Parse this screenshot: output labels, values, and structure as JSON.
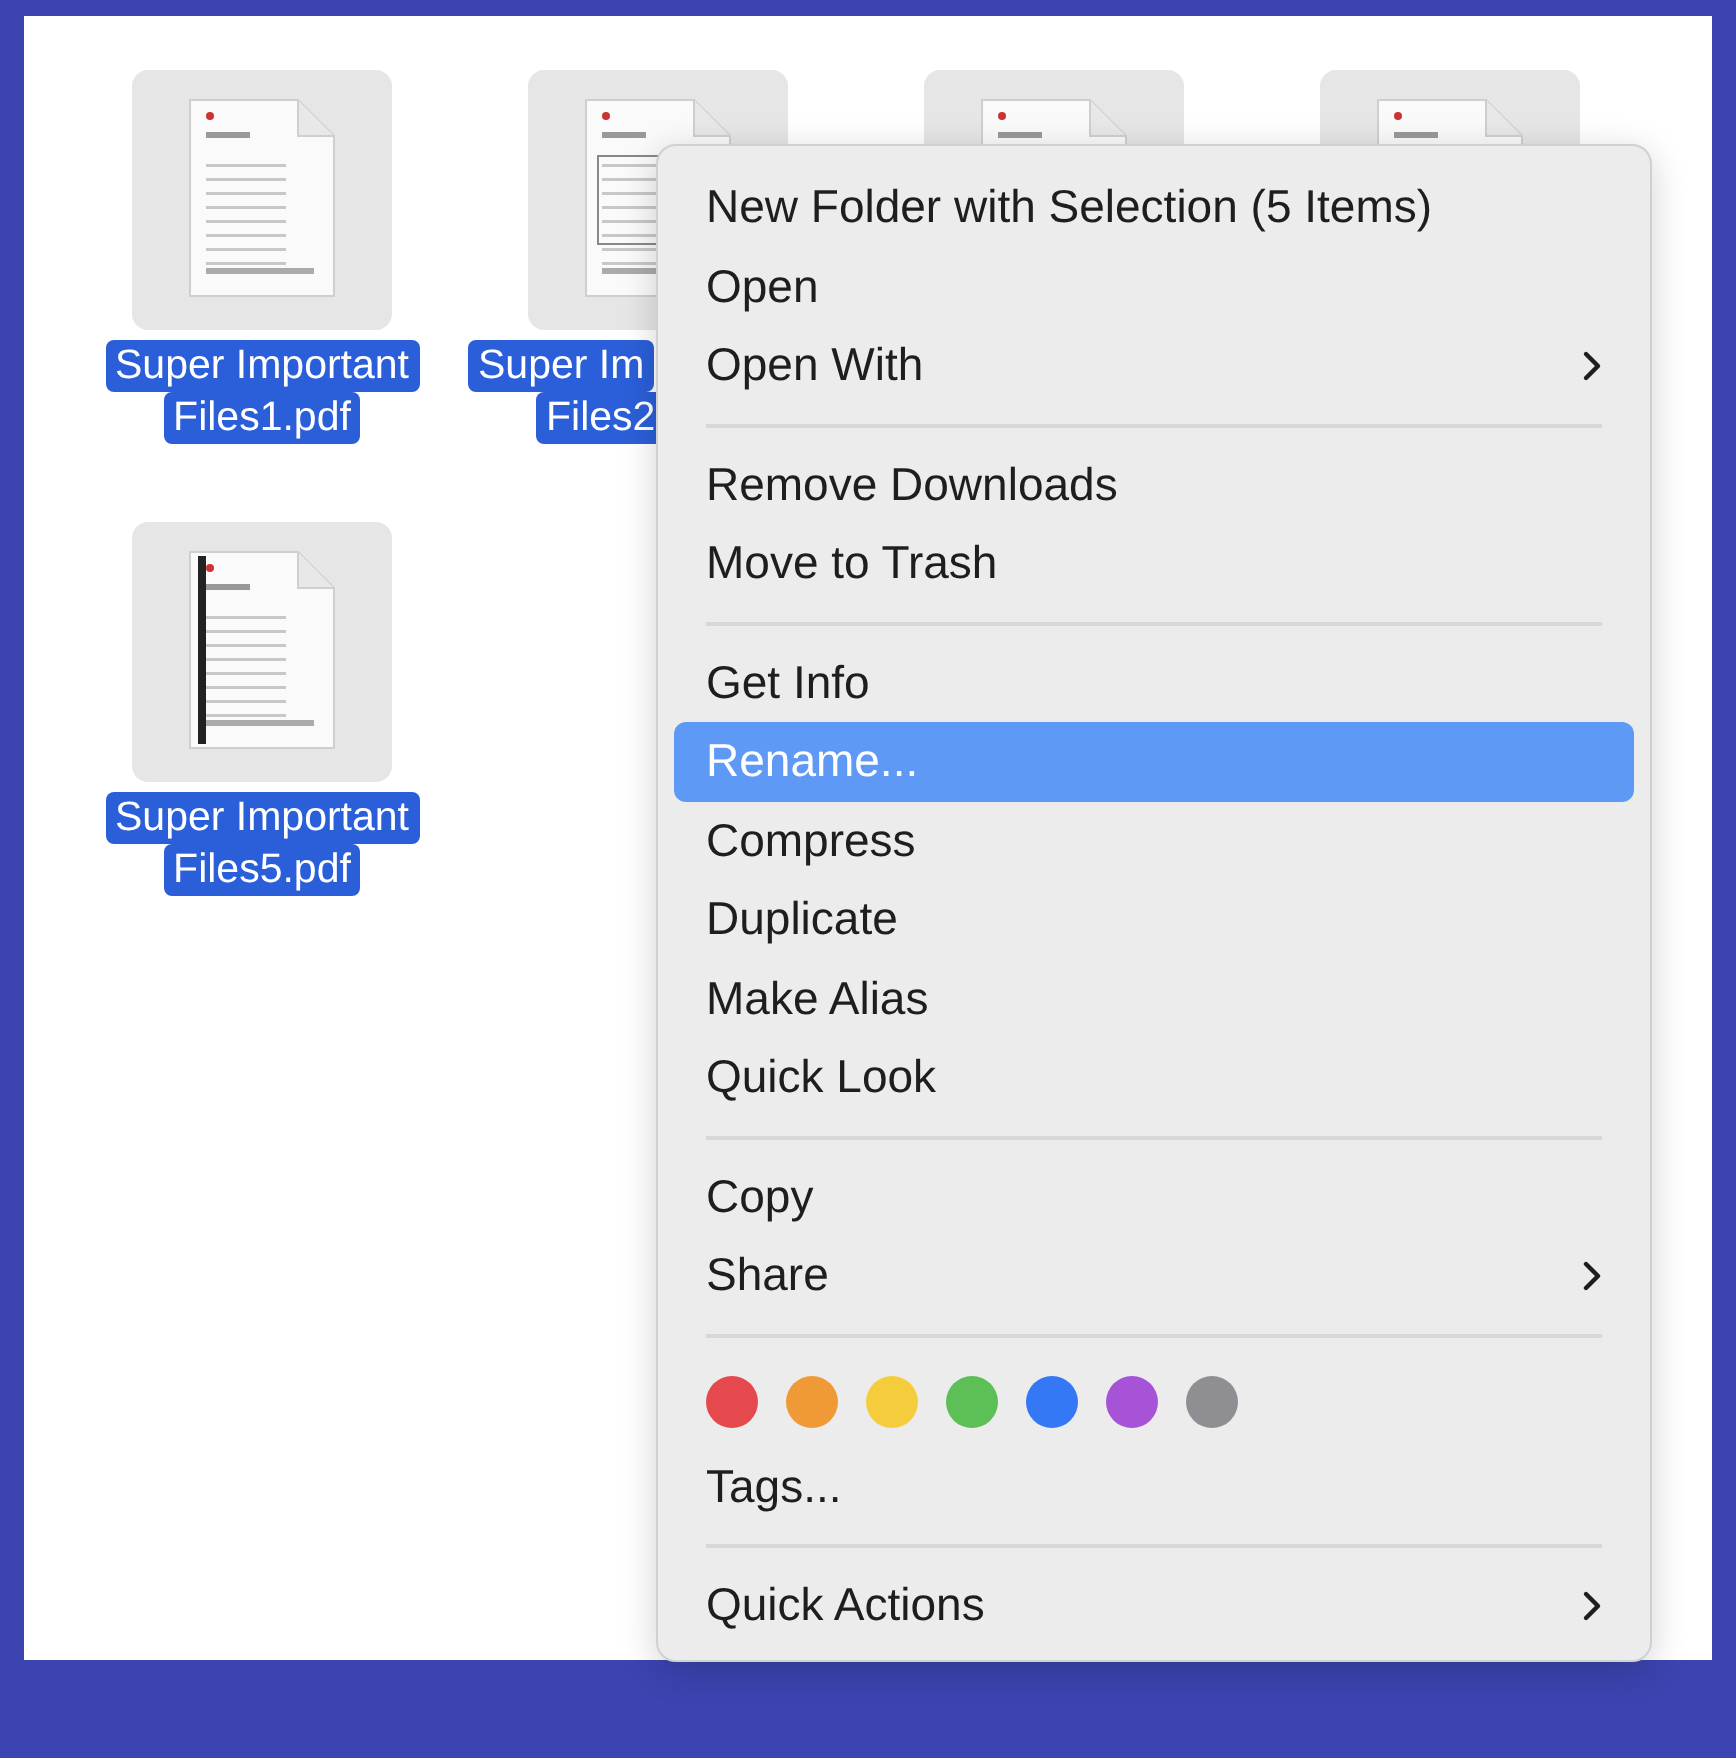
{
  "files": [
    {
      "lines": [
        "Super Important",
        "Files1.pdf"
      ],
      "selected": true
    },
    {
      "lines": [
        "Super Im",
        "Files2"
      ],
      "selected": true
    },
    {
      "selected": true
    },
    {
      "selected": true
    },
    {
      "lines": [
        "Super Important",
        "Files5.pdf"
      ],
      "selected": true
    }
  ],
  "context_menu": {
    "items": [
      {
        "kind": "item",
        "label": "New Folder with Selection (5 Items)",
        "submenu": false,
        "selected": false
      },
      {
        "kind": "item",
        "label": "Open",
        "submenu": false,
        "selected": false
      },
      {
        "kind": "item",
        "label": "Open With",
        "submenu": true,
        "selected": false
      },
      {
        "kind": "separator"
      },
      {
        "kind": "item",
        "label": "Remove Downloads",
        "submenu": false,
        "selected": false
      },
      {
        "kind": "item",
        "label": "Move to Trash",
        "submenu": false,
        "selected": false
      },
      {
        "kind": "separator"
      },
      {
        "kind": "item",
        "label": "Get Info",
        "submenu": false,
        "selected": false
      },
      {
        "kind": "item",
        "label": "Rename...",
        "submenu": false,
        "selected": true
      },
      {
        "kind": "item",
        "label": "Compress",
        "submenu": false,
        "selected": false
      },
      {
        "kind": "item",
        "label": "Duplicate",
        "submenu": false,
        "selected": false
      },
      {
        "kind": "item",
        "label": "Make Alias",
        "submenu": false,
        "selected": false
      },
      {
        "kind": "item",
        "label": "Quick Look",
        "submenu": false,
        "selected": false
      },
      {
        "kind": "separator"
      },
      {
        "kind": "item",
        "label": "Copy",
        "submenu": false,
        "selected": false
      },
      {
        "kind": "item",
        "label": "Share",
        "submenu": true,
        "selected": false
      },
      {
        "kind": "separator"
      },
      {
        "kind": "tags",
        "tags": [
          {
            "color": "#e5484d"
          },
          {
            "color": "#f09a37"
          },
          {
            "color": "#f5cd3c"
          },
          {
            "color": "#5cc056"
          },
          {
            "color": "#3478f6"
          },
          {
            "color": "#a653d8"
          },
          {
            "color": "#8e8e93"
          }
        ]
      },
      {
        "kind": "item",
        "label": "Tags...",
        "submenu": false,
        "selected": false
      },
      {
        "kind": "separator"
      },
      {
        "kind": "item",
        "label": "Quick Actions",
        "submenu": true,
        "selected": false
      }
    ]
  }
}
